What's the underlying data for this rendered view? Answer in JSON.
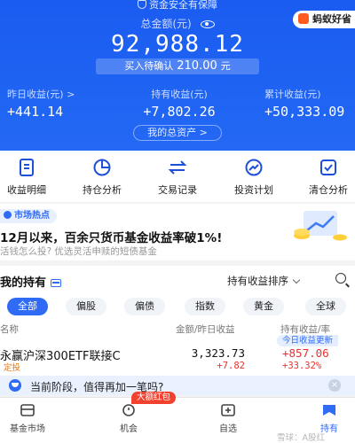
{
  "colors": {
    "brand_blue": "#1f63f3",
    "accent_blue": "#2f6bf5",
    "profit_red": "#e8312f",
    "badge_red": "#f3412f",
    "hot_orange": "#ff5a1f"
  },
  "header": {
    "safety_text": "资金安全有保障",
    "total_label": "总金额(元)",
    "partner_tag": "蚂蚁好省",
    "total_amount": "92,988.12",
    "pending_prefix": "买入待确认",
    "pending_value": "210.00",
    "pending_unit": "元",
    "stats": [
      {
        "label": "昨日收益(元) >",
        "value": "+441.14"
      },
      {
        "label": "持有收益(元)",
        "value": "+7,802.26"
      },
      {
        "label": "累计收益(元)",
        "value": "+50,333.09"
      }
    ],
    "assets_button": "我的总资产 >"
  },
  "actions": [
    {
      "label": "收益明细",
      "icon": "receipt-icon"
    },
    {
      "label": "持仓分析",
      "icon": "pie-chart-icon"
    },
    {
      "label": "交易记录",
      "icon": "trade-record-icon"
    },
    {
      "label": "投资计划",
      "icon": "invest-plan-icon"
    },
    {
      "label": "清仓分析",
      "icon": "clear-position-icon"
    }
  ],
  "market": {
    "tag": "市场热点",
    "title": "12月以来，百余只货币基金收益率破1%!",
    "subtitle": "活钱怎么投? 优选灵活申赎的短债基金"
  },
  "holdings": {
    "title": "我的持有",
    "sort_label": "持有收益排序",
    "filters": [
      "全部",
      "偏股",
      "偏债",
      "指数",
      "黄金",
      "全球"
    ],
    "active_filter": 0,
    "columns": {
      "name": "名称",
      "amount": "金额/昨日收益",
      "holding": "持有收益/率"
    },
    "funds": [
      {
        "today_badge": "今日收益更新",
        "name": "永赢沪深300ETF联接C",
        "type": "定投",
        "amount": "3,323.73",
        "yesterday": "+7.82",
        "holding_profit": "+857.06",
        "holding_rate": "+33.32%"
      }
    ]
  },
  "prompt": {
    "text": "当前阶段，值得再加一笔吗?",
    "close": "×"
  },
  "nav": {
    "items": [
      {
        "label": "基金市场",
        "icon": "fund-market-icon"
      },
      {
        "label": "机会",
        "icon": "opportunity-icon"
      },
      {
        "label": "自选",
        "icon": "watchlist-icon"
      },
      {
        "label": "持有",
        "icon": "holding-icon"
      }
    ],
    "active": 3,
    "red_badge": "大额红包"
  },
  "watermark": "雪球：A股红"
}
